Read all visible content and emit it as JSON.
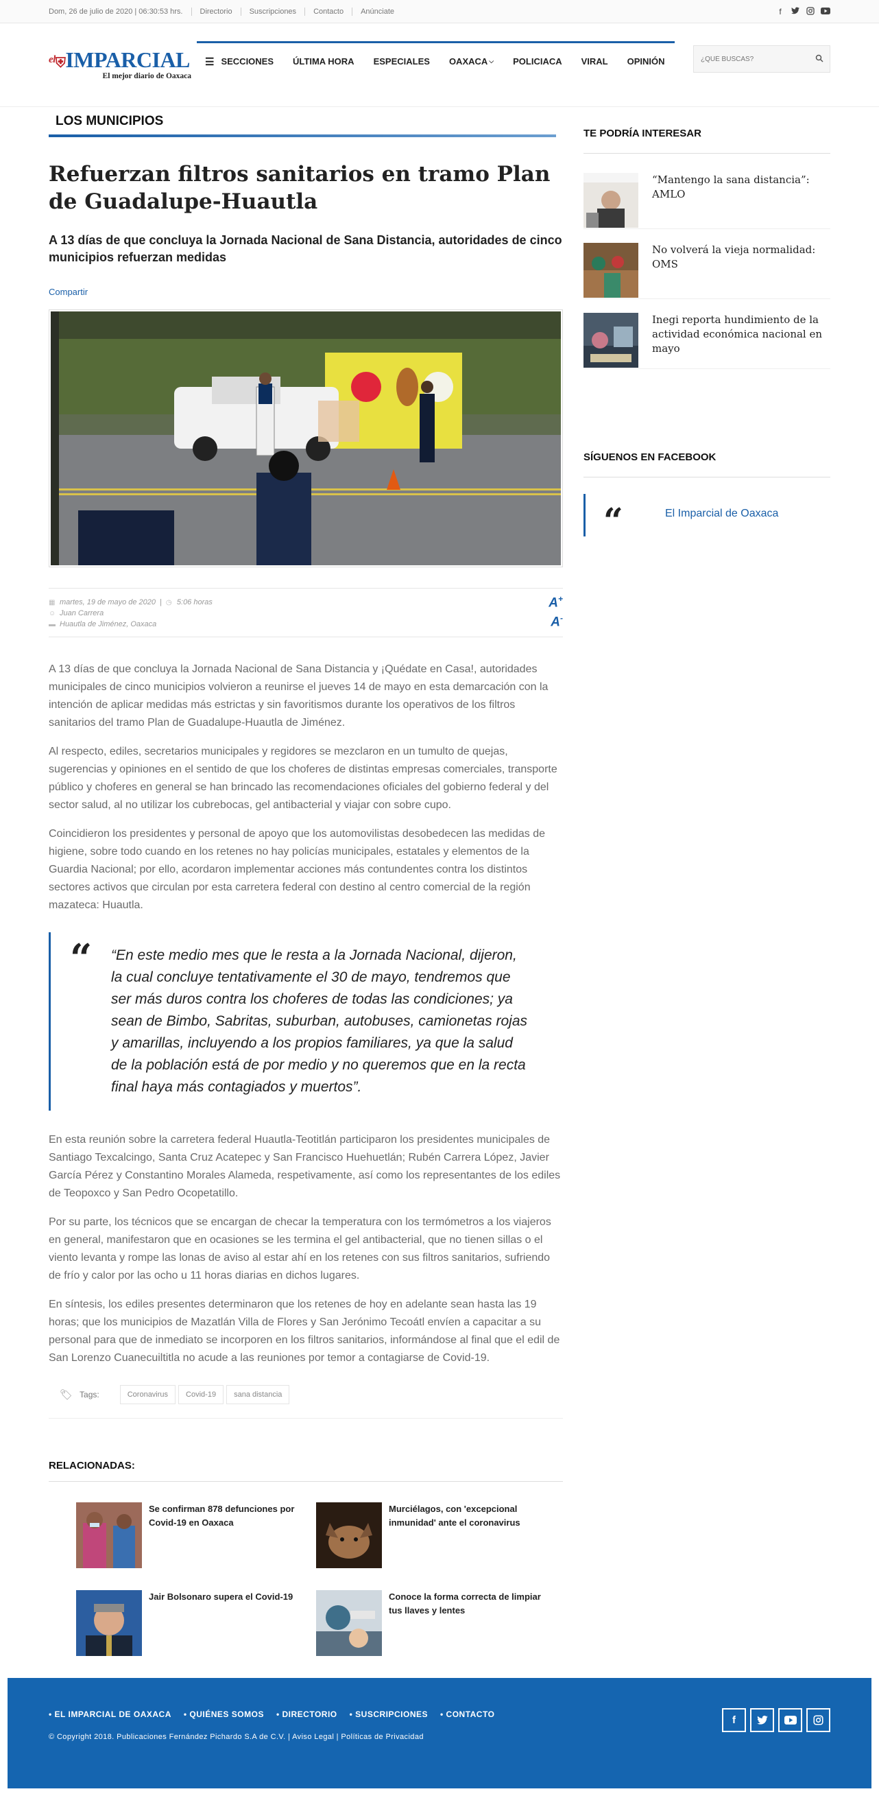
{
  "topbar": {
    "datetime": "Dom, 26 de julio de 2020 | 06:30:53 hrs.",
    "links": [
      "Directorio",
      "Suscripciones",
      "Contacto",
      "Anúnciate"
    ],
    "social": [
      "facebook-icon",
      "twitter-icon",
      "instagram-icon",
      "youtube-icon"
    ]
  },
  "header": {
    "logo_el": "el",
    "logo_name": "IMPARCIAL",
    "logo_tagline": "El mejor diario de Oaxaca",
    "nav": [
      "SECCIONES",
      "ÚLTIMA HORA",
      "ESPECIALES",
      "OAXACA",
      "POLICIACA",
      "VIRAL",
      "OPINIÓN"
    ],
    "search_placeholder": "¿QUÉ BUSCAS?"
  },
  "article": {
    "section": "LOS MUNICIPIOS",
    "title": "Refuerzan filtros sanitarios en tramo Plan de Guadalupe-Huautla",
    "subtitle": "A 13 días de que concluya la Jornada Nacional de Sana Distancia, autoridades de cinco municipios refuerzan medidas",
    "share": "Compartir",
    "date": "martes, 19 de mayo de 2020",
    "time": "5:06 horas",
    "author": "Juan Carrera",
    "location": "Huautla de Jiménez, Oaxaca",
    "font_up": "A",
    "font_down": "A",
    "paragraphs_before": [
      "A 13 días de que concluya la Jornada Nacional de Sana Distancia y ¡Quédate en Casa!, autoridades municipales de cinco municipios volvieron a reunirse el jueves 14 de mayo en esta demarcación con la intención de aplicar medidas más estrictas y sin favoritismos durante los operativos de los filtros sanitarios del tramo Plan de Guadalupe-Huautla de Jiménez.",
      "Al respecto, ediles, secretarios municipales y regidores se mezclaron en un tumulto de quejas, sugerencias y opiniones en el sentido de que los choferes de distintas empresas comerciales, transporte público y choferes en general se han brincado las recomendaciones oficiales del gobierno federal y del sector salud, al no utilizar los cubrebocas, gel antibacterial y viajar con sobre cupo.",
      "Coincidieron los presidentes y personal de apoyo que los automovilistas desobedecen las medidas de higiene, sobre todo cuando en los retenes no hay policías municipales, estatales y elementos de la Guardia Nacional; por ello, acordaron implementar acciones más contundentes contra los distintos sectores activos que circulan por esta carretera federal con destino al centro comercial de la región mazateca: Huautla."
    ],
    "quote": "“En este medio mes que le resta a la Jornada Nacional, dijeron, la cual concluye tentativamente el 30 de mayo, tendremos que ser más duros contra los choferes de todas las condiciones; ya sean de Bimbo, Sabritas, suburban, autobuses, camionetas rojas y amarillas, incluyendo a los propios familiares, ya que la salud de la población está de por medio y no queremos que en la recta final haya más contagiados y muertos”.",
    "paragraphs_after": [
      "En esta reunión sobre la carretera federal Huautla-Teotitlán participaron los presidentes municipales de Santiago Texcalcingo, Santa Cruz Acatepec y San Francisco Huehuetlán; Rubén Carrera López, Javier García Pérez y Constantino Morales Alameda, respetivamente, así como los representantes de los ediles de Teopoxco y San Pedro Ocopetatillo.",
      "Por su parte, los técnicos que se encargan de checar la temperatura con los termómetros a los viajeros en general, manifestaron que en ocasiones se les termina el gel antibacterial, que no tienen sillas o el viento levanta y rompe las lonas de aviso al estar ahí en los retenes con sus filtros sanitarios, sufriendo de frío y calor por las ocho u 11 horas diarias en dichos lugares.",
      "En síntesis, los ediles presentes determinaron que los retenes de hoy en adelante sean hasta las 19 horas; que los municipios de Mazatlán Villa de Flores y San Jerónimo Tecoátl envíen a capacitar a su personal para que de inmediato se incorporen en los filtros sanitarios, informándose al final que el edil de San Lorenzo Cuanecuiltitla no acude a las reuniones por temor a contagiarse de Covid-19."
    ],
    "tags_label": "Tags:",
    "tags": [
      "Coronavirus",
      "Covid-19",
      "sana distancia"
    ]
  },
  "related": {
    "title": "RELACIONADAS:",
    "items": [
      "Se confirman 878 defunciones por Covid-19 en Oaxaca",
      "Murciélagos, con 'excepcional inmunidad' ante el coronavirus",
      "Jair Bolsonaro supera el Covid-19",
      "Conoce la forma correcta de limpiar tus llaves y lentes"
    ]
  },
  "sidebar": {
    "interest_title": "TE PODRÍA INTERESAR",
    "interest_items": [
      "“Mantengo la sana distancia”: AMLO",
      "No volverá la vieja normalidad: OMS",
      "Inegi reporta hundimiento de la actividad económica nacional en mayo"
    ],
    "facebook_title": "SÍGUENOS EN FACEBOOK",
    "facebook_link": "El Imparcial de Oaxaca"
  },
  "footer": {
    "links": [
      "• EL IMPARCIAL DE OAXACA",
      "• QUIÉNES SOMOS",
      "• DIRECTORIO",
      "• SUSCRIPCIONES",
      "• CONTACTO"
    ],
    "copyright": "© Copyright 2018. Publicaciones Fernández Pichardo S.A de C.V. | Aviso Legal | Políticas de Privacidad",
    "social": [
      "facebook-icon",
      "twitter-icon",
      "youtube-icon",
      "instagram-icon"
    ]
  },
  "colors": {
    "brand": "#1a5fa8",
    "footer": "#1565b0",
    "logo_accent": "#c0282d"
  }
}
